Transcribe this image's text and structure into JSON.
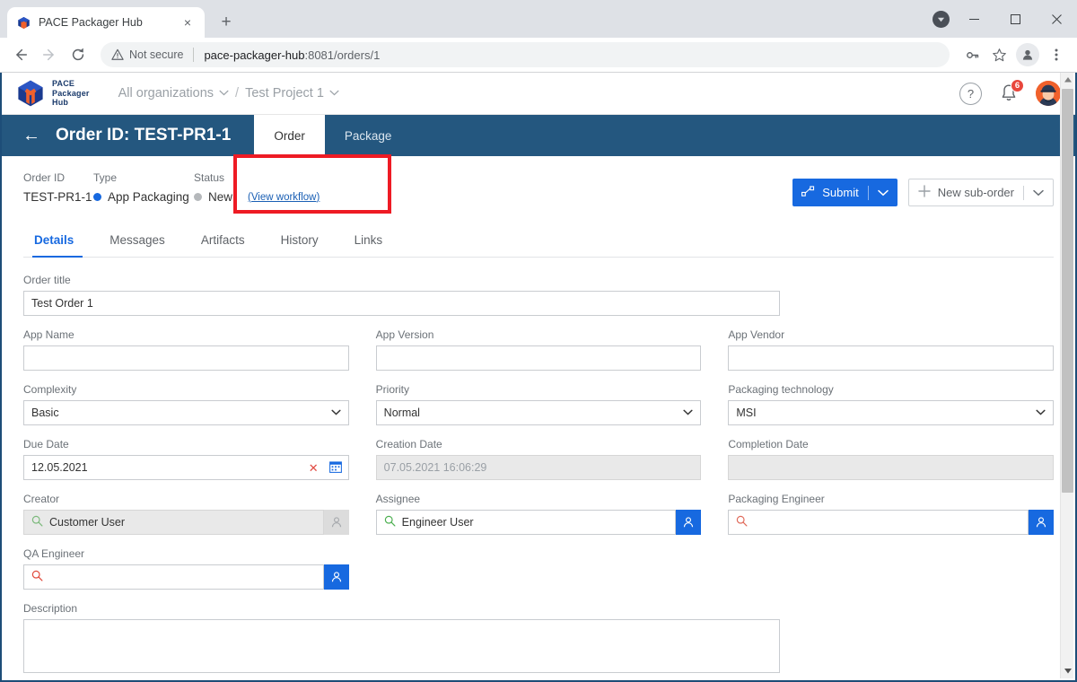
{
  "browser": {
    "tab": {
      "title": "PACE Packager Hub",
      "favicon": "pace-cube-icon",
      "close": "×"
    },
    "new_tab_label": "+",
    "window": {
      "minimize": "−",
      "maximize": "□",
      "close": "✕",
      "download_chevron": "▾"
    },
    "nav": {
      "back": "←",
      "forward": "→",
      "reload": "⟳"
    },
    "omnibox": {
      "security_label": "Not secure",
      "url_host": "pace-packager-hub",
      "url_rest": ":8081/orders/1"
    },
    "toolbar_right": {
      "key_icon": "key-icon",
      "star_icon": "star-icon",
      "profile_icon": "profile-icon",
      "menu_icon": "three-dot-menu-icon"
    }
  },
  "app": {
    "brand": {
      "line1": "PACE",
      "line2": "Packager",
      "line3": "Hub"
    },
    "org_nav": {
      "organization": "All organizations",
      "separator": "/",
      "project": "Test Project 1",
      "chevron": "⌄"
    },
    "header_right": {
      "help": "?",
      "notifications_count": "6",
      "avatar": "user-avatar"
    }
  },
  "order_bar": {
    "back": "←",
    "title": "Order ID: TEST-PR1-1",
    "tabs": [
      {
        "label": "Order",
        "active": true
      },
      {
        "label": "Package",
        "active": false
      }
    ]
  },
  "summary": {
    "order_id": {
      "label": "Order ID",
      "value": "TEST-PR1-1"
    },
    "type": {
      "label": "Type",
      "value": "App Packaging",
      "dot_color": "#1769e0"
    },
    "status": {
      "label": "Status",
      "value": "New",
      "dot_color": "#b5b8bb",
      "link": "(View workflow)"
    },
    "highlight_color": "#ee1b24"
  },
  "actions": {
    "submit": {
      "label": "Submit",
      "icon": "workflow-icon",
      "caret": "⌄",
      "color": "#1769e0"
    },
    "new_sub_order": {
      "label": "New sub-order",
      "icon": "plus-icon",
      "caret": "⌄"
    }
  },
  "detail_tabs": [
    {
      "label": "Details",
      "active": true
    },
    {
      "label": "Messages",
      "active": false
    },
    {
      "label": "Artifacts",
      "active": false
    },
    {
      "label": "History",
      "active": false
    },
    {
      "label": "Links",
      "active": false
    }
  ],
  "form": {
    "order_title": {
      "label": "Order title",
      "value": "Test Order 1"
    },
    "app_name": {
      "label": "App Name",
      "value": ""
    },
    "app_version": {
      "label": "App Version",
      "value": ""
    },
    "app_vendor": {
      "label": "App Vendor",
      "value": ""
    },
    "complexity": {
      "label": "Complexity",
      "value": "Basic",
      "caret": "⌄"
    },
    "priority": {
      "label": "Priority",
      "value": "Normal",
      "caret": "⌄"
    },
    "packaging_technology": {
      "label": "Packaging technology",
      "value": "MSI",
      "caret": "⌄"
    },
    "due_date": {
      "label": "Due Date",
      "value": "12.05.2021",
      "clear": "✕",
      "calendar_icon": "calendar-icon"
    },
    "creation_date": {
      "label": "Creation Date",
      "value": "07.05.2021 16:06:29",
      "disabled": true
    },
    "completion_date": {
      "label": "Completion Date",
      "value": "",
      "disabled": true
    },
    "creator": {
      "label": "Creator",
      "value": "Customer User",
      "disabled": true
    },
    "assignee": {
      "label": "Assignee",
      "value": "Engineer User"
    },
    "packaging_engineer": {
      "label": "Packaging Engineer",
      "value": ""
    },
    "qa_engineer": {
      "label": "QA Engineer",
      "value": ""
    },
    "description": {
      "label": "Description",
      "value": ""
    }
  },
  "scrollbar": {
    "up": "▲",
    "down": "▼"
  }
}
